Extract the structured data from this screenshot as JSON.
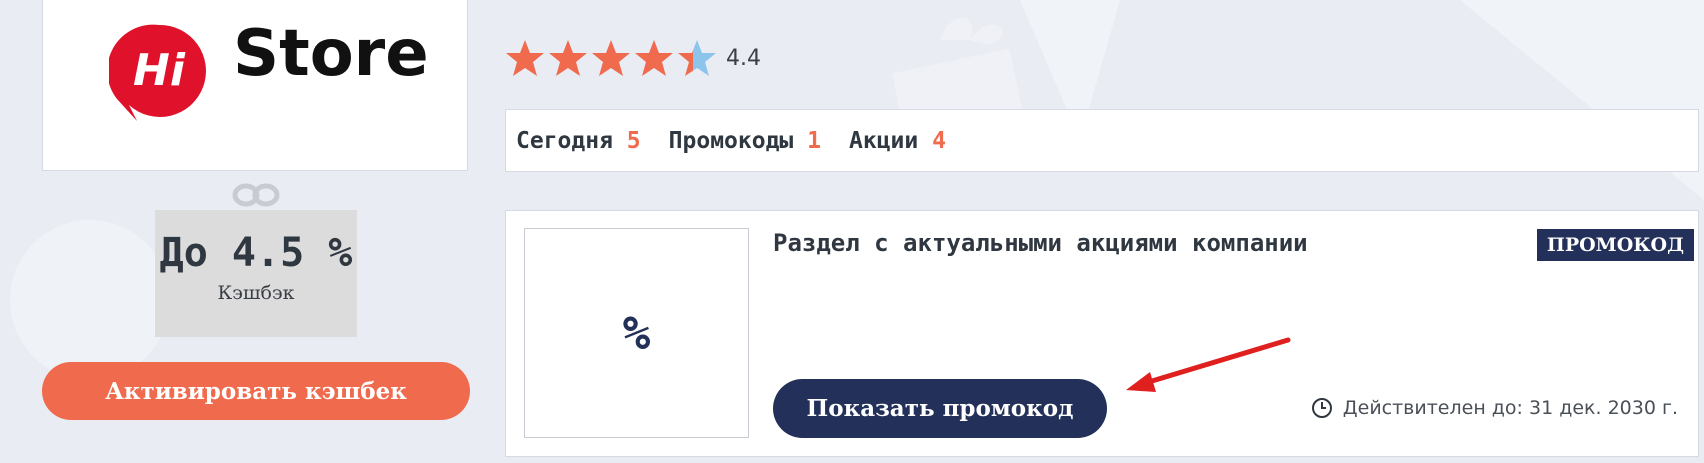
{
  "logo": {
    "hi_text": "Hi",
    "store_text": "Store"
  },
  "rating": {
    "value": "4.4",
    "stars": 4.4,
    "max": 5
  },
  "cashback": {
    "value": "До 4.5 %",
    "label": "Кэшбэк"
  },
  "activate_button": "Активировать кэшбек",
  "tabs": [
    {
      "label": "Сегодня",
      "count": "5"
    },
    {
      "label": "Промокоды",
      "count": "1"
    },
    {
      "label": "Акции",
      "count": "4"
    }
  ],
  "promo": {
    "thumb_symbol": "%",
    "title": "Раздел с актуальными акциями компании",
    "badge": "ПРОМОКОД",
    "show_button": "Показать промокод",
    "valid_until": "Действителен до: 31 дек. 2030 г."
  },
  "colors": {
    "accent": "#f06a4d",
    "navy": "#233059",
    "logo_red": "#e0112b",
    "star_blue": "#8cc4ec",
    "arrow_red": "#e01f1f"
  }
}
